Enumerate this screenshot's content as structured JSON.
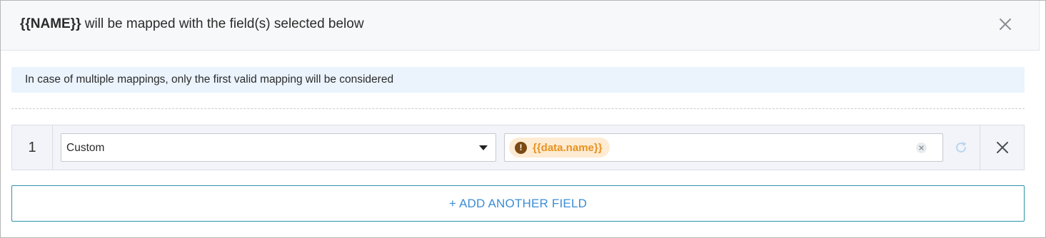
{
  "header": {
    "title_bold": "{{NAME}}",
    "title_rest": " will be mapped with the field(s) selected below",
    "close_icon": "close-icon"
  },
  "info": {
    "text": "In case of multiple mappings, only the first valid mapping will be considered"
  },
  "mappings": [
    {
      "index": "1",
      "source_type": "Custom",
      "value_chip": "{{data.name}}",
      "chip_status_icon": "exclamation-icon",
      "chip_color": "#e8921f"
    }
  ],
  "actions": {
    "add_field_label": "+ ADD ANOTHER FIELD"
  },
  "colors": {
    "accent": "#3b8dd6",
    "button_border": "#2e93a8",
    "info_bg": "#ebf4fd",
    "warning_chip_bg": "#fdebd3"
  }
}
